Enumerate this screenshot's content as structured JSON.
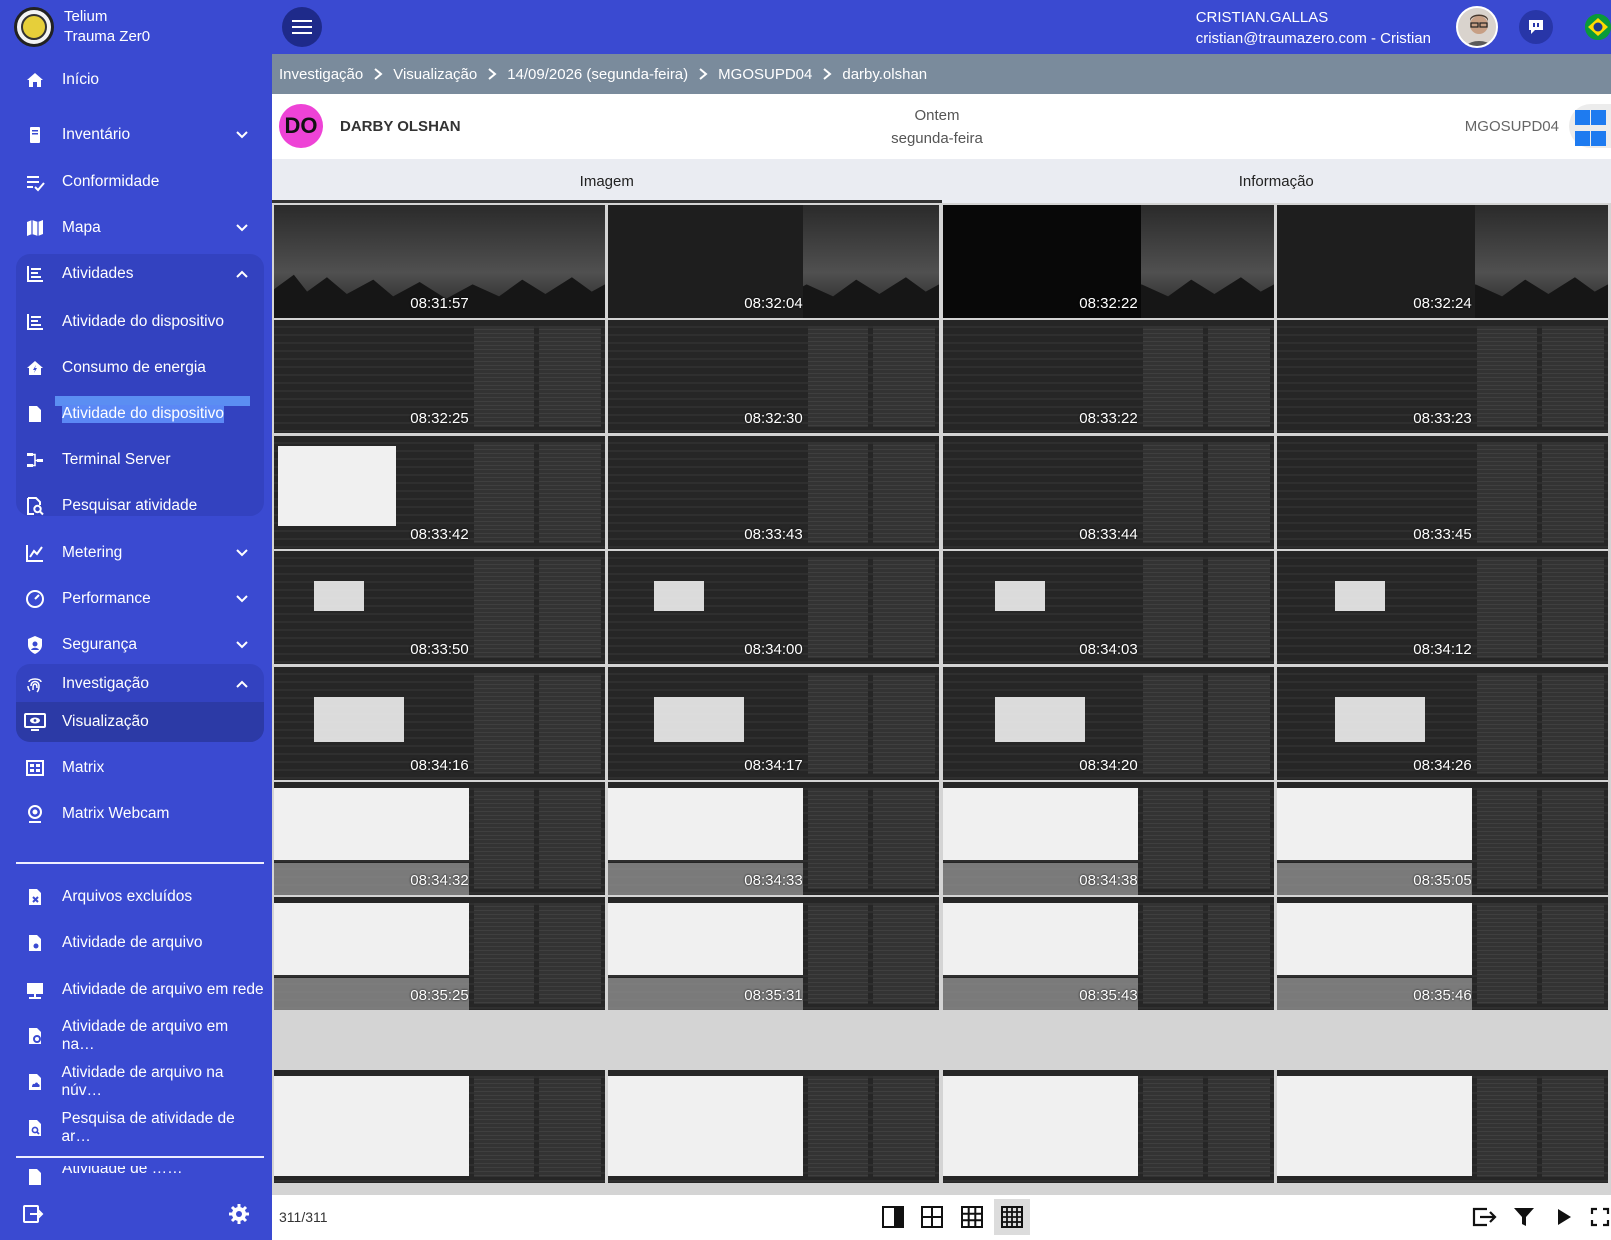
{
  "brand": {
    "line1": "Telium",
    "line2": "Trauma Zer0"
  },
  "nav": {
    "inicio": "Início",
    "inventario": "Inventário",
    "conformidade": "Conformidade",
    "mapa": "Mapa",
    "atividades": "Atividades",
    "atividade_dispositivo": "Atividade do dispositivo",
    "consumo_energia": "Consumo de energia",
    "atividade_dispositivo_2": "Atividade do dispositivo",
    "terminal_server": "Terminal Server",
    "pesquisar_atividade": "Pesquisar atividade",
    "metering": "Metering",
    "performance": "Performance",
    "seguranca": "Segurança",
    "investigacao": "Investigação",
    "visualizacao": "Visualização",
    "matrix": "Matrix",
    "matrix_webcam": "Matrix Webcam",
    "arquivos_excluidos": "Arquivos excluídos",
    "atividade_arquivo": "Atividade de arquivo",
    "atividade_arquivo_rede": "Atividade de arquivo em rede",
    "atividade_arquivo_na": "Atividade de arquivo em na…",
    "atividade_arquivo_nuvem": "Atividade de arquivo na núv…",
    "pesquisa_atividade_arquivo": "Pesquisa de atividade de ar…",
    "atividade_truncated": "Atividade de ……"
  },
  "user": {
    "name": "CRISTIAN.GALLAS",
    "email": "cristian@traumazero.com - Cristian"
  },
  "breadcrumb": [
    "Investigação",
    "Visualização",
    "14/09/2026 (segunda-feira)",
    "MGOSUPD04",
    "darby.olshan"
  ],
  "header": {
    "initials": "DO",
    "name": "DARBY OLSHAN",
    "when_line1": "Ontem",
    "when_line2": "segunda-feira",
    "device": "MGOSUPD04"
  },
  "tabs": [
    "Imagem",
    "Informação"
  ],
  "thumbnails": [
    "08:31:57",
    "08:32:04",
    "08:32:22",
    "08:32:24",
    "08:32:25",
    "08:32:30",
    "08:33:22",
    "08:33:23",
    "08:33:42",
    "08:33:43",
    "08:33:44",
    "08:33:45",
    "08:33:50",
    "08:34:00",
    "08:34:03",
    "08:34:12",
    "08:34:16",
    "08:34:17",
    "08:34:20",
    "08:34:26",
    "08:34:32",
    "08:34:33",
    "08:34:38",
    "08:35:05",
    "08:35:25",
    "08:35:31",
    "08:35:43",
    "08:35:46"
  ],
  "counter": "311/311",
  "colors": {
    "sidebar": "#3a4ad1",
    "selected_thumb": "#29d37a",
    "avatar_initials_bg": "#ee43d6"
  }
}
